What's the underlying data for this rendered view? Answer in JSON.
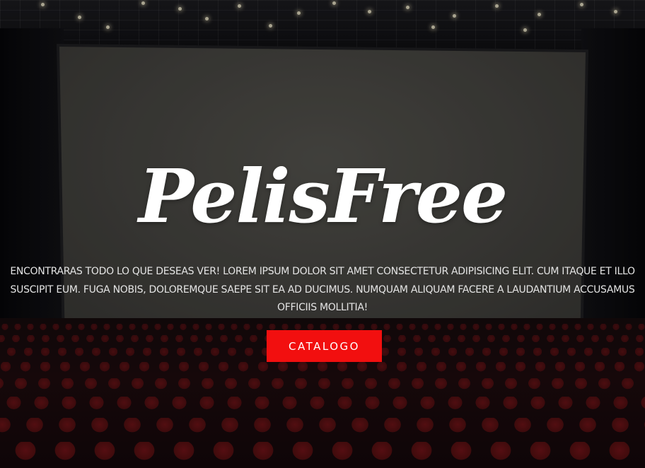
{
  "hero": {
    "brand": "PelisFree",
    "description": "ENCONTRARAS TODO LO QUE DESEAS VER! LOREM IPSUM DOLOR SIT AMET CONSECTETUR ADIPISICING ELIT. CUM ITAQUE ET ILLO SUSCIPIT EUM. FUGA NOBIS, DOLOREMQUE SAEPE SIT EA AD DUCIMUS. NUMQUAM ALIQUAM FACERE A LAUDANTIUM ACCUSAMUS OFFICIIS MOLLITIA!",
    "cta_label": "CATALOGO"
  },
  "colors": {
    "accent": "#f20f0f",
    "text": "#ffffff",
    "background": "#0c0c0f",
    "seat": "#7a1418"
  },
  "background_image": "cinema-theater-with-screen-and-red-seats"
}
